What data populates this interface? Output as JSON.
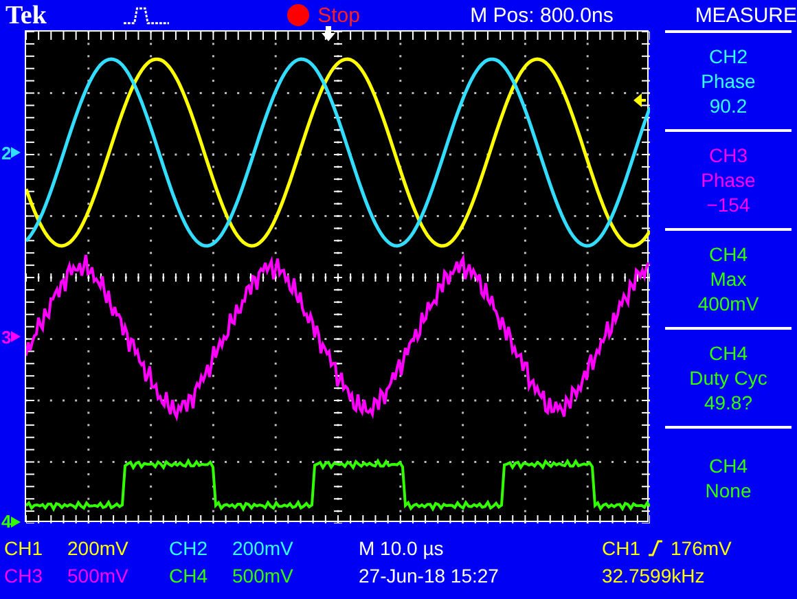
{
  "header": {
    "logo": "Tek",
    "run_state": "Stop",
    "position": "M Pos: 800.0ns",
    "menu_title": "MEASURE"
  },
  "ground_markers": [
    {
      "label": "2",
      "color": "#33ddff"
    },
    {
      "label": "3",
      "color": "#ff00ff"
    },
    {
      "label": "4",
      "color": "#33ff00"
    }
  ],
  "measurements": [
    {
      "source": "CH2",
      "type": "Phase",
      "value": "90.2",
      "color": "#33ffff"
    },
    {
      "source": "CH3",
      "type": "Phase",
      "value": "−154",
      "color": "#ff00ff"
    },
    {
      "source": "CH4",
      "type": "Max",
      "value": "400mV",
      "color": "#33ff00"
    },
    {
      "source": "CH4",
      "type": "Duty Cyc",
      "value": "49.8?",
      "color": "#33ff00"
    },
    {
      "source": "CH4",
      "type": "None",
      "color": "#33ff00"
    }
  ],
  "status": {
    "channels": [
      {
        "name": "CH1",
        "scale": "200mV",
        "color": "#ffff00"
      },
      {
        "name": "CH2",
        "scale": "200mV",
        "color": "#33ffff"
      },
      {
        "name": "CH3",
        "scale": "500mV",
        "color": "#ff00ff"
      },
      {
        "name": "CH4",
        "scale": "500mV",
        "color": "#33ff00"
      }
    ],
    "timebase": "M 10.0 µs",
    "date": "27-Jun-18 15:27",
    "trigger": {
      "source": "CH1",
      "level": "176mV",
      "color": "#ffff00"
    },
    "frequency": "32.7599kHz"
  }
}
